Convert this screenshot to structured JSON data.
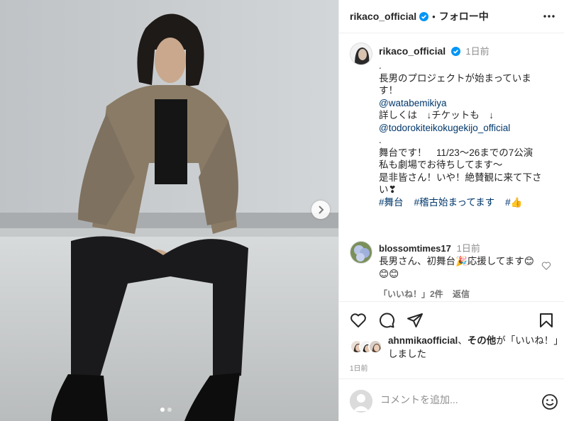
{
  "post": {
    "username": "rikaco_official",
    "separator": "•",
    "follow_state": "フォロー中",
    "media": {
      "slide_count": 2,
      "current_slide": 1
    }
  },
  "caption": {
    "username": "rikaco_official",
    "time": "1日前",
    "lines": [
      ".",
      "長男のプロジェクトが始まっていま",
      "す！",
      "@watabemikiya",
      "詳しくは　↓チケットも　↓",
      "@todorokiteikokugekijo_official",
      ".",
      "舞台です！　11/23～26までの7公演",
      "私も劇場でお待ちしてます〜",
      "是非皆さん！いや！絶賛観に来て下さ",
      "い❣"
    ],
    "hashtags": [
      "#舞台",
      "#稽古始まってます",
      "#👍"
    ]
  },
  "comment": {
    "username": "blossomtimes17",
    "time": "1日前",
    "text": "長男さん、初舞台🎉応援してます😊😊😊",
    "likes_label": "「いいね！」2件",
    "reply_label": "返信"
  },
  "likes": {
    "first_user": "ahnmikaofficial",
    "connector": "、",
    "others": "その他",
    "suffix": "が「いいね！」しました"
  },
  "timestamp": "1日前",
  "comment_box": {
    "placeholder": "コメントを追加..."
  },
  "icons": {
    "verified": "verified-badge-icon",
    "more": "more-options-icon",
    "like": "heart-icon",
    "comment": "comment-icon",
    "share": "paper-plane-icon",
    "save": "bookmark-icon",
    "emoji": "emoji-icon",
    "next": "chevron-right-icon"
  },
  "colors": {
    "link": "#00376b",
    "verified": "#0095f6",
    "muted": "#8e8e8e"
  }
}
